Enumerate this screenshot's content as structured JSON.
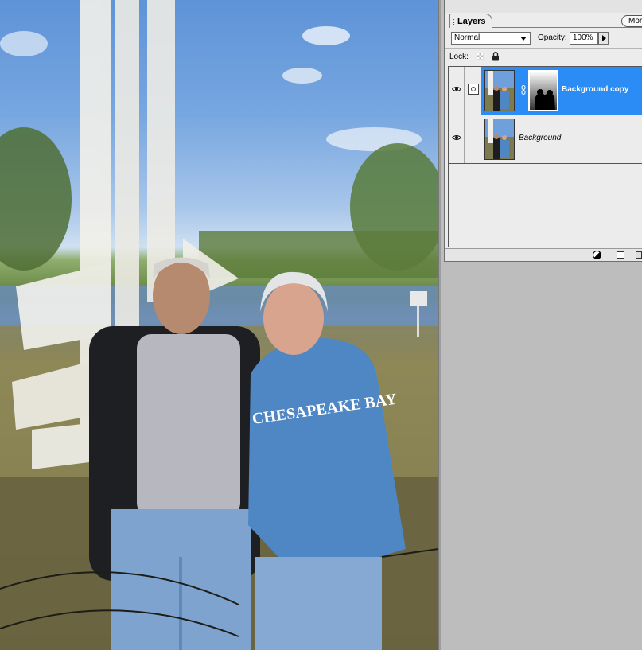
{
  "palette": {
    "tab_label": "Layers",
    "more_button": "More",
    "blend_mode": "Normal",
    "opacity_label": "Opacity:",
    "opacity_value": "100%",
    "lock_label": "Lock:",
    "layers": [
      {
        "name": "Background copy",
        "selected": true,
        "visible": true,
        "has_mask": true
      },
      {
        "name": "Background",
        "selected": false,
        "visible": true,
        "has_mask": false
      }
    ]
  },
  "colors": {
    "selection": "#2b8cf6",
    "sky": "#6ea1de",
    "hoodie": "#4f87c4",
    "panel_bg": "#ececec",
    "workspace_bg": "#bdbdbd"
  },
  "icons": [
    "eye-icon",
    "brush-icon",
    "chain-icon",
    "lock-all-icon",
    "lock-transparent-icon",
    "adjustment-layer-icon",
    "new-layer-icon",
    "trash-icon"
  ]
}
